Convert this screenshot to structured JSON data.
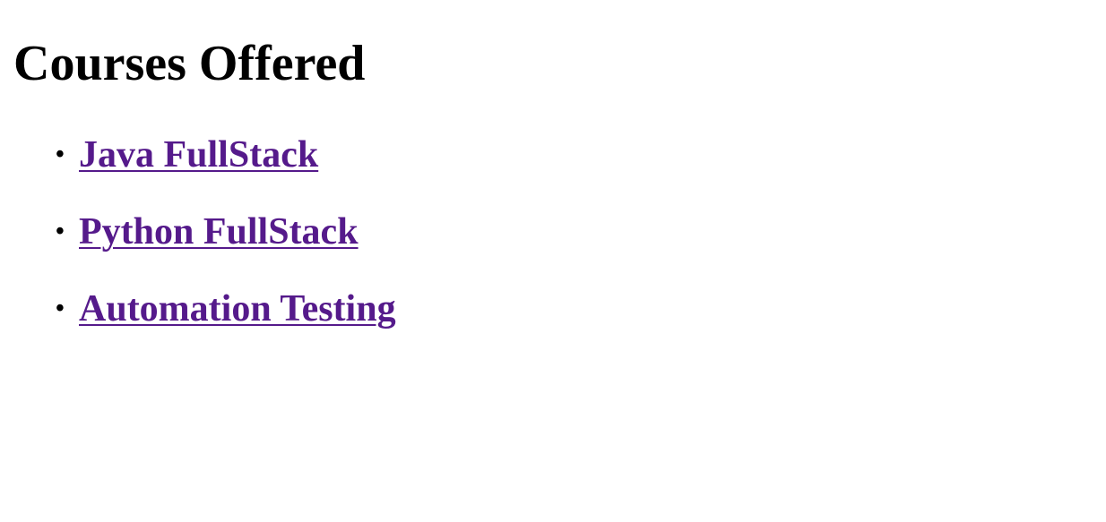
{
  "page": {
    "title": "Courses Offered"
  },
  "courses": [
    {
      "label": "Java FullStack"
    },
    {
      "label": "Python FullStack"
    },
    {
      "label": "Automation Testing"
    }
  ],
  "colors": {
    "visited_link": "#551A8B",
    "text": "#000000",
    "background": "#FFFFFF"
  }
}
